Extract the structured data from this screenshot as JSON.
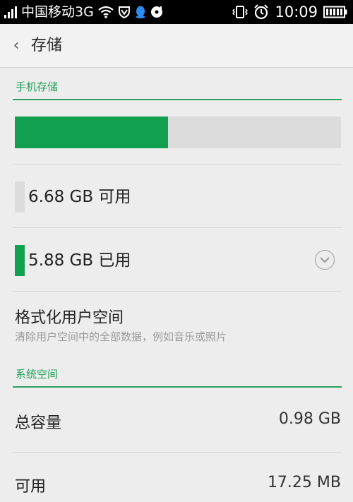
{
  "status_bar": {
    "carrier": "中国移动3G",
    "time": "10:09",
    "icons": [
      "signal-icon",
      "wifi-icon",
      "vpn-shield-icon",
      "qq-icon",
      "music-icon",
      "vibrate-icon",
      "alarm-icon",
      "battery-icon"
    ]
  },
  "header": {
    "back_icon": "‹",
    "title": "存储"
  },
  "phone_storage": {
    "section_title": "手机存储",
    "used_fraction": 0.47,
    "colors": {
      "used": "#12a150",
      "available": "#dcdcdc"
    },
    "available_label": "6.68 GB 可用",
    "used_label": "5.88 GB 已用"
  },
  "format": {
    "title": "格式化用户空间",
    "subtitle": "清除用户空间中的全部数据，例如音乐或照片"
  },
  "system_space": {
    "section_title": "系统空间",
    "rows": [
      {
        "label": "总容量",
        "value": "0.98 GB"
      },
      {
        "label": "可用",
        "value": "17.25 MB"
      }
    ]
  }
}
